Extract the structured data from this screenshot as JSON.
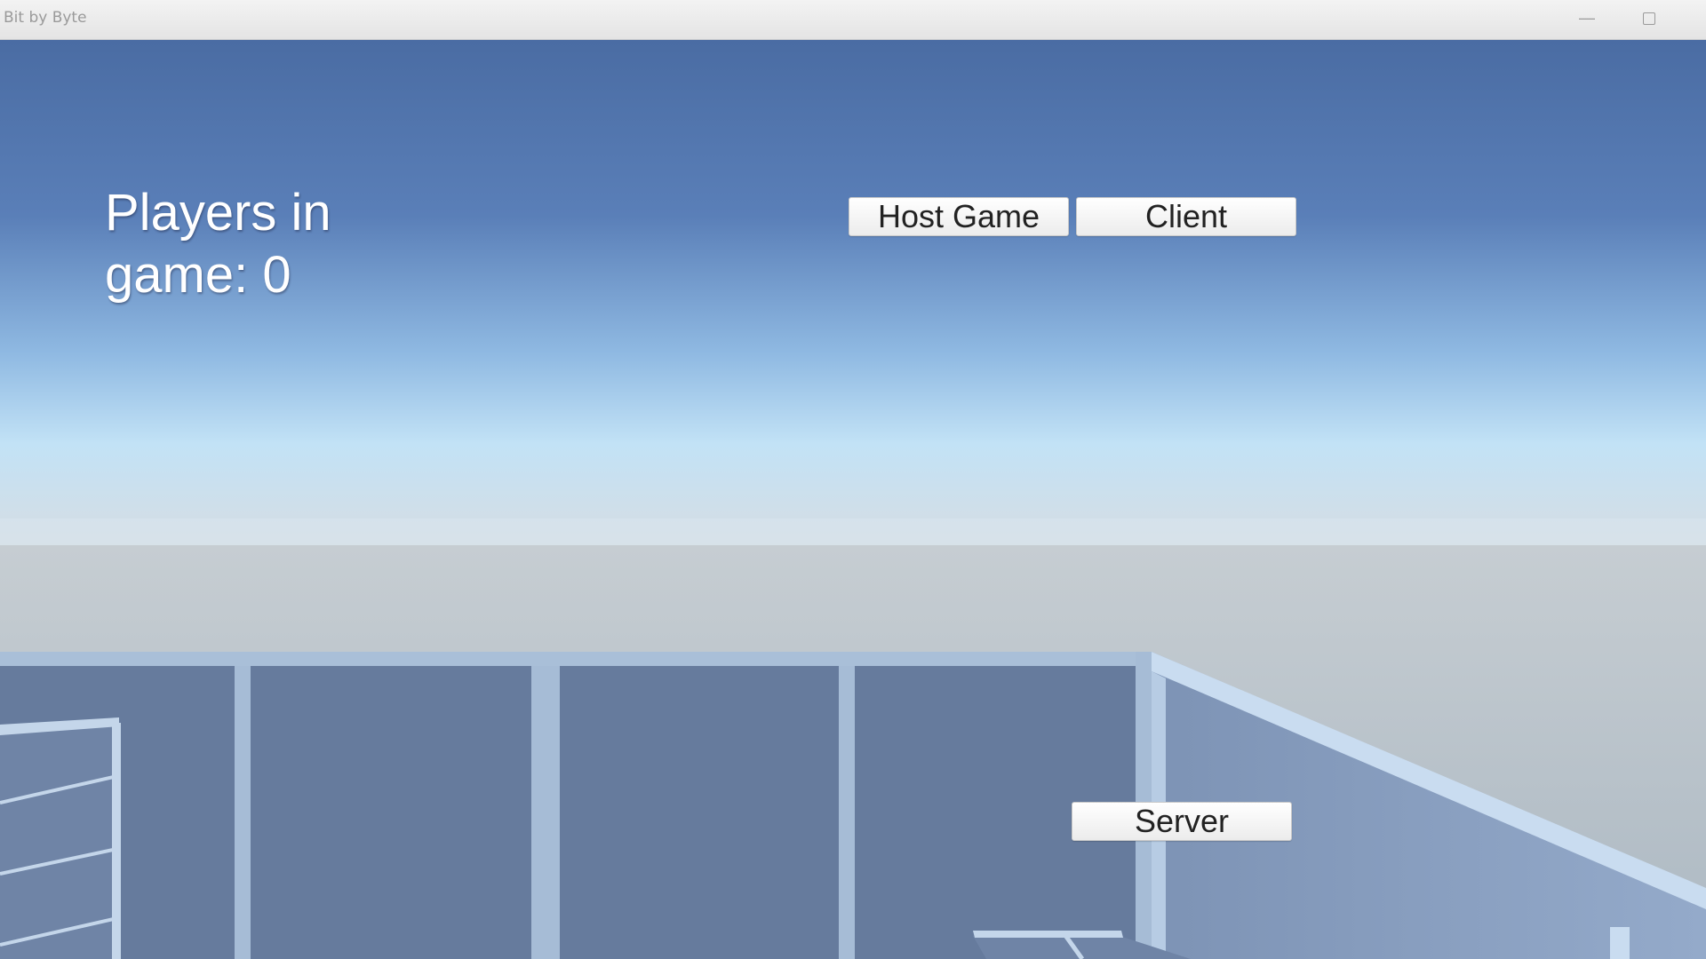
{
  "window": {
    "title": "Bit by Byte",
    "minimize_glyph": "—"
  },
  "hud": {
    "players_label": "Players in game: 0"
  },
  "menu": {
    "host_label": "Host Game",
    "client_label": "Client",
    "server_label": "Server"
  },
  "colors": {
    "sky_top": "#3f5f92",
    "sky_horizon": "#b9dcf4",
    "ground": "#b2bdc6",
    "panel": "#667b9d",
    "frame": "#a6bcd6",
    "frame_highlight": "#c9dcf0"
  }
}
